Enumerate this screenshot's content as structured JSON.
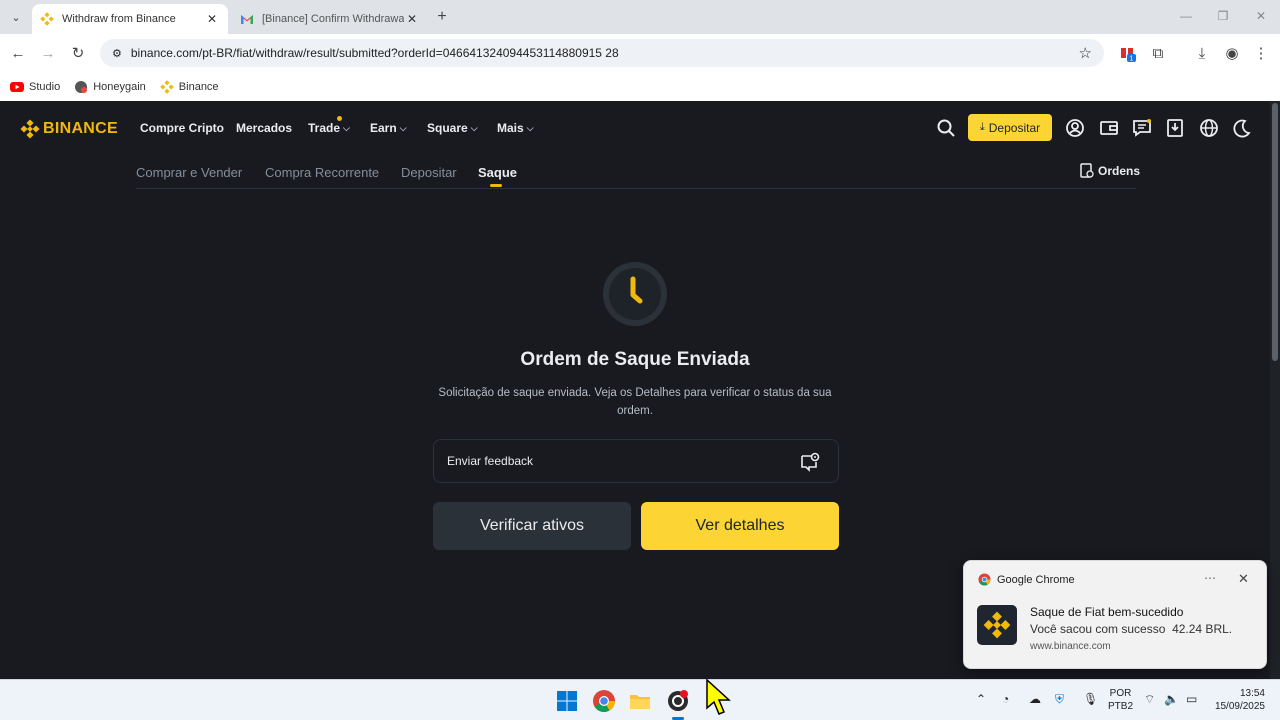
{
  "browser": {
    "tabs": [
      {
        "title": "Withdraw from Binance",
        "active": true
      },
      {
        "title": "[Binance] Confirm Withdrawal/",
        "active": false
      }
    ],
    "url": "binance.com/pt-BR/fiat/withdraw/result/submitted?orderId=046641324094453114880915 28",
    "bookmarks": [
      "Studio",
      "Honeygain",
      "Binance"
    ],
    "extension_badge": "1"
  },
  "site": {
    "logo": "BINANCE",
    "nav": [
      "Compre Cripto",
      "Mercados",
      "Trade",
      "Earn",
      "Square",
      "Mais"
    ],
    "deposit_button": "Depositar",
    "subnav": [
      "Comprar e Vender",
      "Compra Recorrente",
      "Depositar",
      "Saque"
    ],
    "orders": "Ordens",
    "title": "Ordem de Saque Enviada",
    "description": "Solicitação de saque enviada. Veja os Detalhes para verificar o status da sua ordem.",
    "feedback": "Enviar feedback",
    "btn_verify": "Verificar ativos",
    "btn_details": "Ver detalhes",
    "accent": "#f0b90b",
    "background": "#181a20"
  },
  "notification": {
    "app": "Google Chrome",
    "title": "Saque de Fiat bem-sucedido",
    "body": "Você sacou com sucesso  42.24 BRL.",
    "source": "www.binance.com"
  },
  "taskbar": {
    "lang_line1": "POR",
    "lang_line2": "PTB2",
    "time": "13:54",
    "date": "15/09/2025"
  }
}
